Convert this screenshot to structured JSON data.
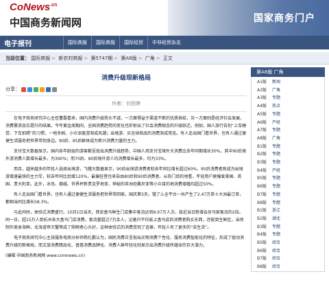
{
  "header": {
    "logo_en": "CoNews",
    "logo_en_sup": ".cn",
    "logo_zh": "中国商务新闻网",
    "portal": "国家商务门户"
  },
  "nav": {
    "title": "电子报刊",
    "items": [
      "国际商报",
      "国际商报",
      "国际经贸",
      "中非经贸杂志"
    ]
  },
  "breadcrumb": {
    "label": "当前位置：",
    "items": [
      "国际商报",
      "新农村商报",
      "第5747期",
      "第A8版",
      "广角",
      "正文"
    ]
  },
  "article": {
    "title": "消费升级现新格局",
    "share_label": "分享：",
    "author": "作者：刘旭婷",
    "paragraphs": [
      "在电子商务研究中心主任曹磊看来，国内消费升级势头不减，一方面得益于渠道不断的优质供给，另一方面则是经济社会发展，消费需求品位提升的结果。今年黄金周期间，全国消费趋势的变化也折射出了社会消费观念的升级跃迁。例如，国人旅行告别“上车睡觉、下车拍照”的习惯，一地多刷、小众深度游渐成风潮；出境游、买全球商品的消费渐成常态。有人走出国门看世界，也有人通过便捷生活服务把世界带到身边。90后、95后群体成为新兴消费力量的主力。",
      "支付宝大数据显示，国内各年龄层的游客都呈现出消费升级趋势，中国人用支付宝境外大消费比去年同期增长30%，其中90后境外游消费人数增长最多，为390%；而70后、80后境外游人均消费增长最多，均为33%。",
      "而且，越来越多的年轻人选择出境游，飞猪大数据显示，90后出境游消费者较去年同比增长超过60%，95后消费者则成为出境游增速最快的主力军，较去年同比劲增120%，最偏任菩也来自由80后和90后消费者。从热门目的地看，年轻用户更偏爱美国、英国、贵大利亚。此外，冰岛、挪威、世界杯新贵克罗地亚、神秘的非洲坦桑尼亚等小众目的地消费增幅均超过50%。",
      "有人走出国门看世界，也有人通过便捷生活服务把世界带回家。国庆第3天，饿了么全平台一共产生了2.47万单十大洲最订单，都相当同比增长58.3%。",
      "与此同时，体验式消费盛行。10月1日当天，西安盒马鲜生门店集中客流达到8.97万人次，接近当日新增会员马家客流的2倍。同一日，超15万人到杭州各大盒马门店消费，客流量超过7万余人。记着只不仅能上盒马店的消费者购买东西，还能到生鲜区，当场制作美食海鲜，北海道帝王蟹等成了购物者心头好，这种体验式的消费受到了追捧，年轻人有了更多的“去生活”。",
      "电子商务研究中心主张服务电商分析师杨扎鹏认为，国民消费正呈现出买物消费个性化、服务消费智能化的特征，形成了驱动消费升级的新格局，而文旅消费精品化、普惠消费品牌化、消费人群年轻化则显示出消费升级所蕴含的巨大潜力。"
    ],
    "source": "(编辑 中国商务新闻网 www.comnews.cn)"
  },
  "sidebar": {
    "header": "第A8版 广角",
    "items": [
      {
        "num": "A1版",
        "name": "新闻"
      },
      {
        "num": "A2版",
        "name": "广角"
      },
      {
        "num": "A3版",
        "name": "专题"
      },
      {
        "num": "A4版",
        "name": "热点"
      },
      {
        "num": "A5版",
        "name": "专题"
      },
      {
        "num": "A6版",
        "name": "产经"
      },
      {
        "num": "A7版",
        "name": "专题"
      },
      {
        "num": "A8版",
        "name": "广角"
      },
      {
        "num": "B1版",
        "name": "专题"
      },
      {
        "num": "B2版",
        "name": "专题"
      },
      {
        "num": "B3版",
        "name": "专题"
      },
      {
        "num": "B4版",
        "name": "产经"
      },
      {
        "num": "B5版",
        "name": "专题"
      },
      {
        "num": "B6版",
        "name": "专题"
      },
      {
        "num": "B7版",
        "name": "专题"
      },
      {
        "num": "B8版",
        "name": "专题"
      },
      {
        "num": "B1版",
        "name": "浙江"
      },
      {
        "num": "B2版",
        "name": "湖北"
      },
      {
        "num": "B3版",
        "name": "专题"
      },
      {
        "num": "B4版",
        "name": "专题"
      },
      {
        "num": "B5版",
        "name": "综合"
      },
      {
        "num": "B6版",
        "name": "综合"
      },
      {
        "num": "B7版",
        "name": "综合"
      },
      {
        "num": "B8版",
        "name": "综合"
      }
    ]
  },
  "colors": {
    "brand_red": "#b5121b",
    "nav_blue": "#39547f",
    "title_blue": "#1e3e72"
  }
}
